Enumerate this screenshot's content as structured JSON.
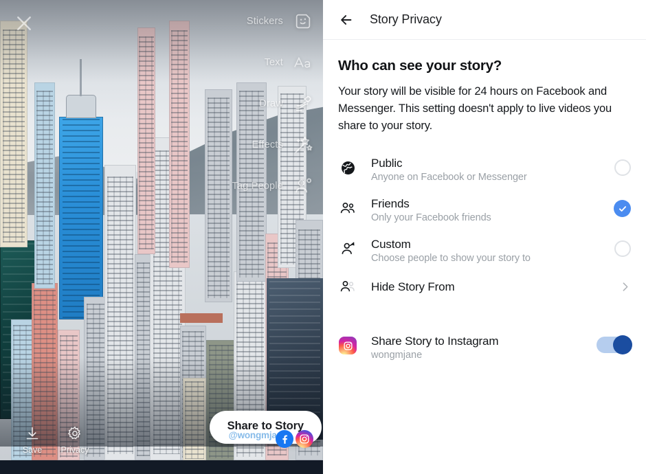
{
  "composer": {
    "close_icon": "close-x-icon",
    "tools": [
      {
        "label": "Stickers",
        "icon": "sticker-face-icon"
      },
      {
        "label": "Text",
        "icon": "text-aa-icon"
      },
      {
        "label": "Draw",
        "icon": "draw-marker-icon"
      },
      {
        "label": "Effects",
        "icon": "magic-wand-sparkle-icon"
      },
      {
        "label": "Tag People",
        "icon": "tag-person-icon"
      }
    ],
    "bottom_actions": [
      {
        "label": "Save",
        "icon": "download-arrow-icon"
      },
      {
        "label": "Privacy",
        "icon": "gear-icon"
      }
    ],
    "share_pill": {
      "label": "Share to Story",
      "watermark": "@wongmjane",
      "icons": [
        "facebook-icon",
        "instagram-icon"
      ]
    }
  },
  "panel": {
    "header": {
      "back_icon": "arrow-left-icon",
      "title": "Story Privacy"
    },
    "question": "Who can see your story?",
    "description": "Your story will be visible for 24 hours on Facebook and Messenger. This setting doesn't apply to live videos you share to your story.",
    "options": [
      {
        "title": "Public",
        "subtitle": "Anyone on Facebook or Messenger",
        "icon": "globe-icon",
        "control": "radio",
        "selected": false
      },
      {
        "title": "Friends",
        "subtitle": "Only your Facebook friends",
        "icon": "two-people-icon",
        "control": "radio",
        "selected": true
      },
      {
        "title": "Custom",
        "subtitle": "Choose people to show your story to",
        "icon": "person-edit-icon",
        "control": "radio",
        "selected": false
      }
    ],
    "hide_row": {
      "title": "Hide Story From",
      "icon": "person-hidden-icon",
      "control": "chevron-right"
    },
    "instagram_row": {
      "title": "Share Story to Instagram",
      "subtitle": "wongmjane",
      "icon": "instagram-icon",
      "control": "toggle",
      "enabled": true
    }
  },
  "colors": {
    "accent_blue": "#4b8cf0",
    "toggle_track": "#b5cdee",
    "toggle_knob": "#1b4da0",
    "facebook_blue": "#1877f2",
    "text_primary": "#14171a",
    "text_secondary": "#9aa0a6"
  }
}
